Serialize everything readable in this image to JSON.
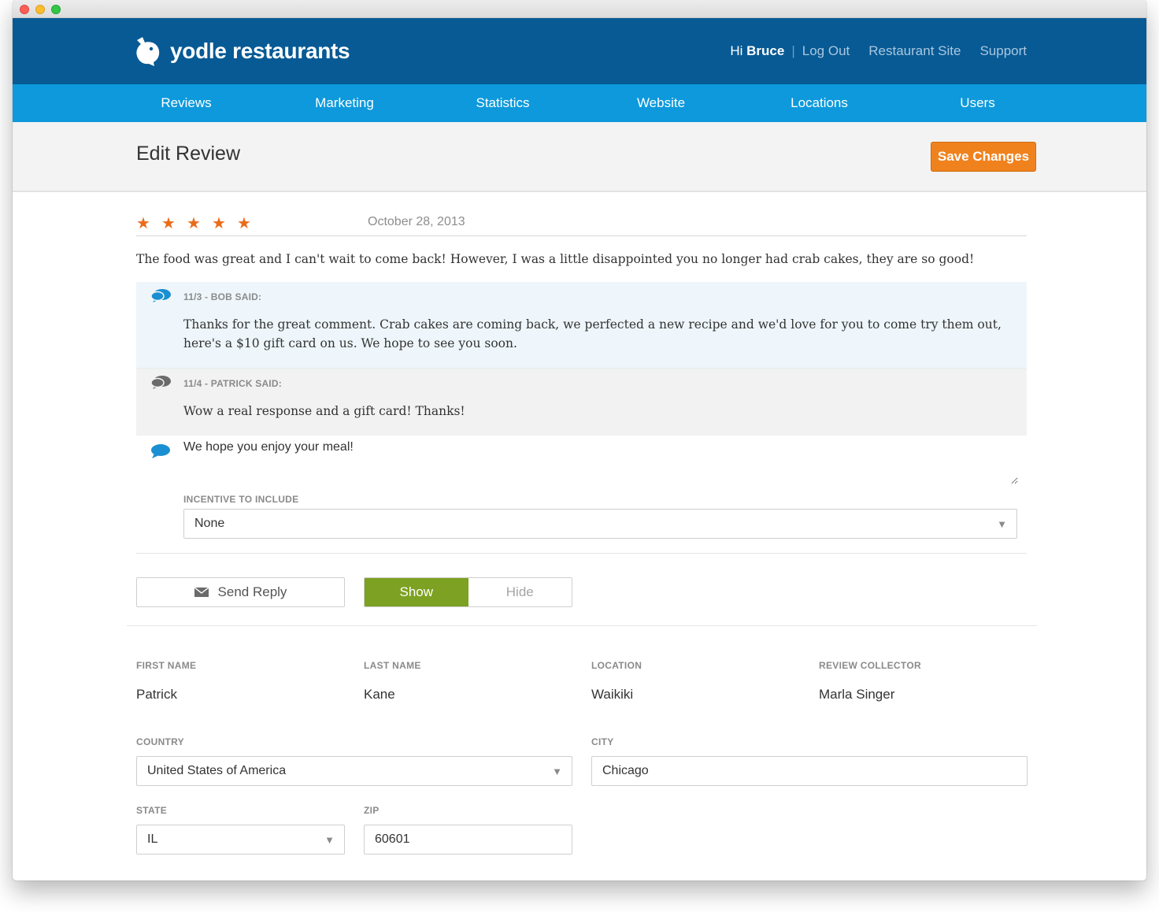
{
  "brand": {
    "name": "yodle restaurants"
  },
  "user_nav": {
    "greeting": "Hi",
    "user_name": "Bruce",
    "logout": "Log Out",
    "restaurant_site": "Restaurant Site",
    "support": "Support"
  },
  "main_nav": [
    "Reviews",
    "Marketing",
    "Statistics",
    "Website",
    "Locations",
    "Users"
  ],
  "page": {
    "title": "Edit Review",
    "save_label": "Save Changes"
  },
  "review": {
    "rating": 5,
    "date": "October 28, 2013",
    "text": "The food was great and I can't wait to come back! However, I was a little disappointed you no longer had crab cakes, they are so good!"
  },
  "thread": [
    {
      "header": "11/3 - BOB SAID:",
      "body": "Thanks for the great comment. Crab cakes are coming back, we perfected a new recipe and we'd love for you to come try them out, here's a $10 gift card on us. We hope to see you soon."
    },
    {
      "header": "11/4 - PATRICK SAID:",
      "body": "Wow a real response and a gift card! Thanks!"
    }
  ],
  "reply": {
    "value": "We hope you enjoy your meal!",
    "incentive_label": "INCENTIVE TO INCLUDE",
    "incentive_value": "None"
  },
  "actions": {
    "send_reply": "Send Reply",
    "show": "Show",
    "hide": "Hide",
    "visibility": "Show"
  },
  "customer": {
    "first_name_label": "FIRST NAME",
    "first_name": "Patrick",
    "last_name_label": "LAST NAME",
    "last_name": "Kane",
    "location_label": "LOCATION",
    "location": "Waikiki",
    "collector_label": "REVIEW COLLECTOR",
    "collector": "Marla Singer",
    "country_label": "COUNTRY",
    "country": "United States of America",
    "city_label": "CITY",
    "city": "Chicago",
    "state_label": "STATE",
    "state": "IL",
    "zip_label": "ZIP",
    "zip": "60601"
  },
  "colors": {
    "topbar": "#075a94",
    "nav": "#0d99dc",
    "save": "#f0821e",
    "star": "#e96c1b",
    "show_active": "#7da122"
  },
  "icons": {
    "reply": "speech-bubble-icon",
    "send": "envelope-icon",
    "select": "chevron-down-icon",
    "star": "star-icon"
  }
}
